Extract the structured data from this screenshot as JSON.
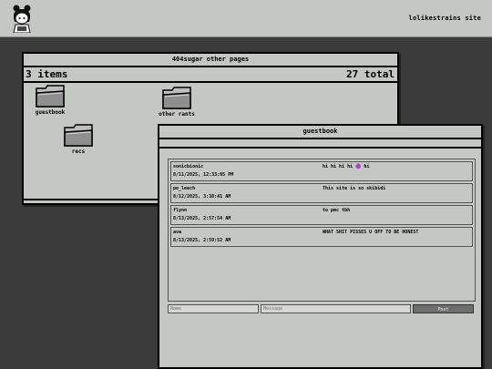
{
  "header": {
    "site_link": "lolikestrains site"
  },
  "folder_window": {
    "title": "404sugar other pages",
    "item_count": "3 items",
    "total": "27 total",
    "folders": [
      {
        "label": "guestbook"
      },
      {
        "label": "other rants"
      },
      {
        "label": "recs"
      }
    ]
  },
  "guestbook_window": {
    "title": "guestbook",
    "entries": [
      {
        "name": "sonicbionic",
        "date": "8/11/2025, 12:33:05 PM",
        "message": "hi hi hi hi 🟣 hi"
      },
      {
        "name": "po_leech",
        "date": "8/12/2025, 3:38:41 AM",
        "message": "This site is so skibidi"
      },
      {
        "name": "flynn",
        "date": "8/13/2025, 2:57:54 AM",
        "message": "to pmc tbh"
      },
      {
        "name": "ava",
        "date": "8/13/2025, 2:59:52 AM",
        "message": "WHAT SHIT PISSES U OFF TO BE HONEST"
      }
    ],
    "form": {
      "name_placeholder": "Name",
      "message_placeholder": "Message",
      "post_label": "Post"
    }
  }
}
